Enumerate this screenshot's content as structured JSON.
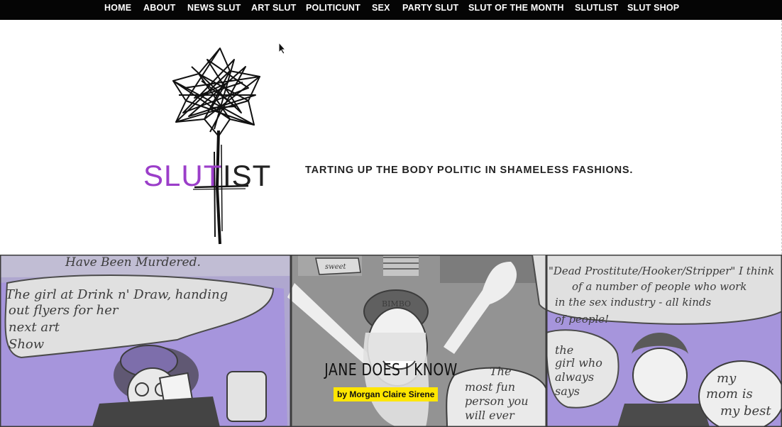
{
  "nav": {
    "items": [
      "HOME",
      "ABOUT",
      "NEWS SLUT",
      "ART SLUT",
      "POLITICUNT",
      "SEX",
      "PARTY SLUT",
      "SLUT OF THE MONTH",
      "SLUTLIST",
      "SLUT SHOP"
    ]
  },
  "header": {
    "logo_left": "SLUT",
    "logo_right": "IST",
    "tagline": "TARTING UP THE BODY POLITIC IN SHAMELESS FASHIONS."
  },
  "hero": {
    "title": "JANE DOES I KNOW",
    "byline": "by Morgan Claire Sirene",
    "comic_text": {
      "murdered": "Have Been Murdered.",
      "bubble_left_1": "The girl at Drink n' Draw, handing",
      "bubble_left_2": "out flyers for her",
      "bubble_left_3": "next art",
      "bubble_left_4": "Show",
      "hat": "BIMBO",
      "sweet": "sweet",
      "bubble_right_1": "\"Dead Prostitute/Hooker/Stripper\" I think",
      "bubble_right_2": "of a number of people who work",
      "bubble_right_3": "in the sex industry - all kinds",
      "bubble_right_4": "of people!",
      "girl_who_1": "the",
      "girl_who_2": "girl who",
      "girl_who_3": "always",
      "girl_who_4": "says",
      "most_fun_1": "The",
      "most_fun_2": "most fun",
      "most_fun_3": "person you",
      "most_fun_4": "will ever",
      "mom_1": "my",
      "mom_2": "mom is",
      "mom_3": "my best"
    }
  },
  "colors": {
    "nav_bg": "#050505",
    "logo_purple": "#9b3ec9",
    "byline_bg": "#ffe600",
    "comic_purple": "#9a87d8"
  }
}
